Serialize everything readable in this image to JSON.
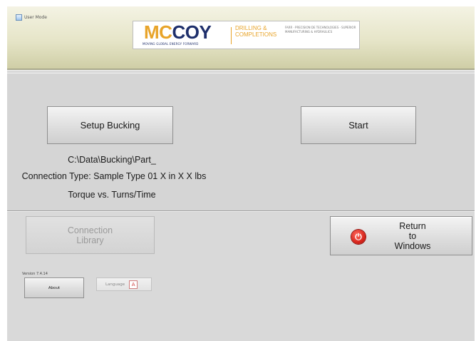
{
  "header": {
    "user_mode_label": "User Mode",
    "logo": {
      "brand_part1": "MC",
      "brand_part2": "COY",
      "tagline": "MOVING GLOBAL ENERGY FORWARD",
      "division": "DRILLING & COMPLETIONS",
      "sub_lines": "FARR · PRECISION DE TECHNOLOGIES · SUPERIOR MANUFACTURING & HYDRAULICS"
    }
  },
  "main": {
    "setup_button": "Setup Bucking",
    "start_button": "Start",
    "path": "C:\\Data\\Bucking\\Part_",
    "connection_type": "Connection Type:  Sample Type 01 X in X X lbs",
    "chart_mode": "Torque vs. Turns/Time"
  },
  "footer": {
    "library_button_line1": "Connection",
    "library_button_line2": "Library",
    "return_line1": "Return",
    "return_line2": "to",
    "return_line3": "Windows",
    "version": "Version 7.4.14",
    "about_button": "About",
    "language_button": "Language",
    "language_icon_glyph": "A"
  },
  "colors": {
    "header_bg": "#e6e5c8",
    "panel_bg": "#d5d5d5",
    "brand_gold": "#e8a42a",
    "brand_navy": "#1e2f6b",
    "power_red": "#d8261d"
  },
  "icons": {
    "power": "power-icon",
    "language": "language-icon",
    "checkbox": "checkbox-icon"
  }
}
